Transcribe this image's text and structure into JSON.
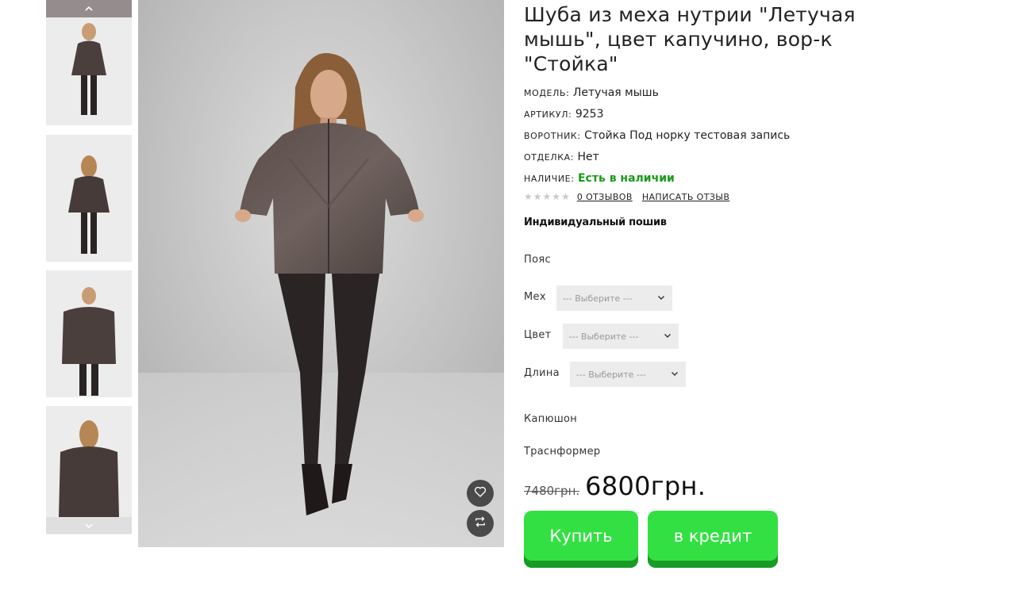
{
  "product": {
    "title": "Шуба из меха нутрии \"Летучая мышь\", цвет капучино, вор-к \"Стойка\"",
    "props": [
      {
        "label": "МОДЕЛЬ:",
        "value": "Летучая мышь"
      },
      {
        "label": "АРТИКУЛ:",
        "value": "9253"
      },
      {
        "label": "ВОРОТНИК:",
        "value": "Стойка Под норку тестовая запись"
      },
      {
        "label": "ОТДЕЛКА:",
        "value": "Нет"
      },
      {
        "label": "НАЛИЧИЕ:",
        "value": "Есть в наличии"
      }
    ],
    "rating": 0,
    "rating_max": 5,
    "reviews_link": "0 ОТЗЫВОВ",
    "write_review_link": "НАПИСАТЬ ОТЗЫВ",
    "custom_tailoring": "Индивидуальный пошив"
  },
  "options": {
    "belt_label": "Пояс",
    "fur_label": "Мех",
    "color_label": "Цвет",
    "length_label": "Длина",
    "hood_label": "Капюшон",
    "transformer_label": "Траснформер",
    "select_placeholder": "--- Выберите ---"
  },
  "price": {
    "old": "7480грн.",
    "new": "6800грн."
  },
  "buttons": {
    "buy": "Купить",
    "credit": "в кредит"
  },
  "colors": {
    "accent_green": "#33e043",
    "in_stock": "#1a9a1a"
  },
  "icons": {
    "thumb_up": "chevron-up-icon",
    "thumb_down": "chevron-down-icon",
    "wishlist": "heart-icon",
    "compare": "compare-icon",
    "select": "chevron-down-icon",
    "star": "star-icon"
  }
}
